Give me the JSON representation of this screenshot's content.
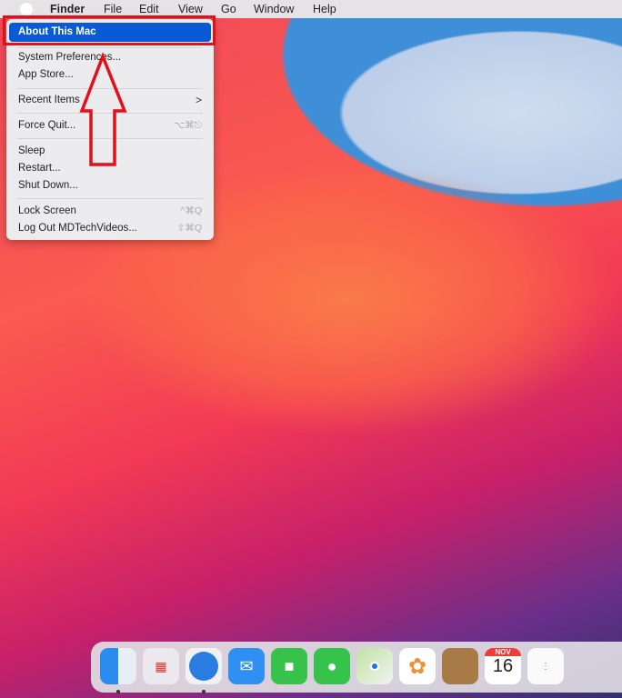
{
  "menubar": {
    "items": [
      "Finder",
      "File",
      "Edit",
      "View",
      "Go",
      "Window",
      "Help"
    ]
  },
  "apple_menu": {
    "highlighted": "About This Mac",
    "items": [
      {
        "label": "System Preferences..."
      },
      {
        "label": "App Store..."
      },
      {
        "label": "Recent Items",
        "submenu": ">"
      },
      {
        "label": "Force Quit...",
        "shortcut": "⌥⌘⎋"
      },
      {
        "label": "Sleep"
      },
      {
        "label": "Restart..."
      },
      {
        "label": "Shut Down..."
      },
      {
        "label": "Lock Screen",
        "shortcut": "^⌘Q"
      },
      {
        "label": "Log Out MDTechVideos...",
        "shortcut": "⇧⌘Q"
      }
    ]
  },
  "dock": {
    "calendar_month": "NOV",
    "calendar_day": "16",
    "apps": [
      "finder-icon",
      "launchpad-icon",
      "safari-icon",
      "mail-icon",
      "facetime-icon",
      "messages-icon",
      "maps-icon",
      "photos-icon",
      "contacts-icon",
      "calendar-icon",
      "reminders-icon"
    ]
  },
  "annotation_color": "#e0101c"
}
